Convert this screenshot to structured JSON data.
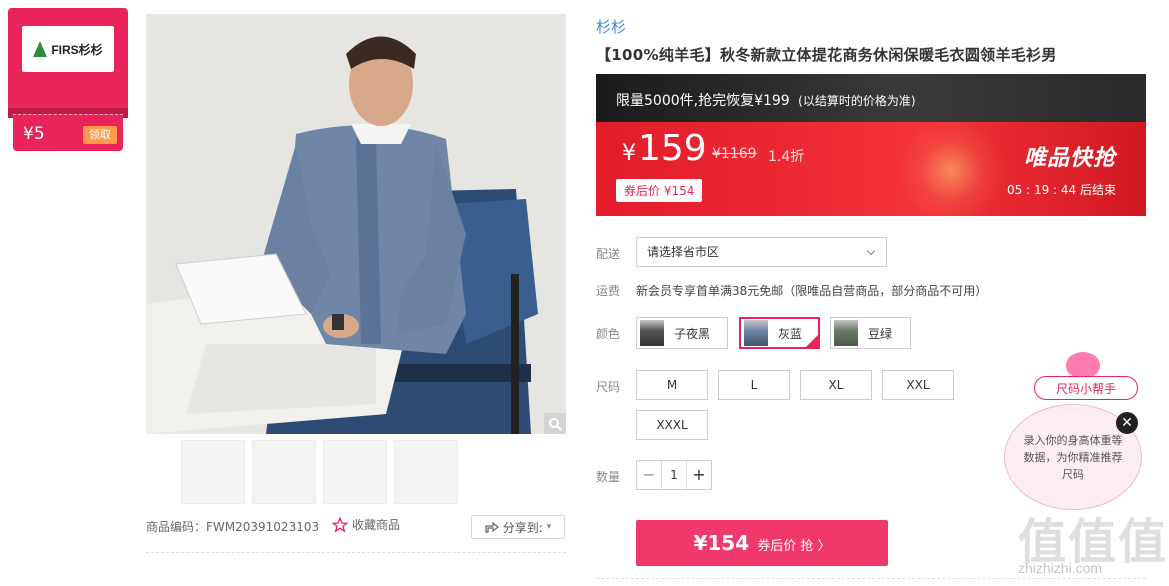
{
  "coupon": {
    "brand_logo_text": "FIRS杉杉",
    "amount": "¥5",
    "claim_label": "领取"
  },
  "gallery": {
    "sku_label": "商品编码：FWM20391023103",
    "favorite_label": "收藏商品",
    "share_label": "分享到:"
  },
  "product": {
    "brand": "杉杉",
    "title": "【100%纯羊毛】秋冬新款立体提花商务休闲保暖毛衣圆领羊毛衫男"
  },
  "promo": {
    "limit_text": "限量5000件,抢完恢复¥199",
    "limit_note": "(以结算时的价格为准)",
    "price_symbol": "¥",
    "price": "159",
    "original_price": "¥1169",
    "discount": "1.4折",
    "coupon_price": "券后价 ¥154",
    "flash_label": "唯品快抢",
    "countdown": "05 : 19 : 44  后结束"
  },
  "delivery": {
    "label": "配送",
    "placeholder": "请选择省市区"
  },
  "freight": {
    "label": "运费",
    "text": "新会员专享首单满38元免邮（限唯品自营商品，部分商品不可用）"
  },
  "colors": {
    "label": "颜色",
    "options": [
      "子夜黑",
      "灰蓝",
      "豆绿"
    ],
    "selected": "灰蓝"
  },
  "sizes": {
    "label": "尺码",
    "options": [
      "M",
      "L",
      "XL",
      "XXL",
      "XXXL"
    ]
  },
  "quantity": {
    "label": "数量",
    "minus": "−",
    "value": "1",
    "plus": "+"
  },
  "buy_button": {
    "price": "¥154",
    "suffix": "券后价 抢 〉"
  },
  "size_helper": {
    "tag": "尺码小帮手",
    "text": "录入你的身高体重等数据，为你精准推荐尺码",
    "close": "✕"
  },
  "watermark": {
    "glyphs": "值值值",
    "url": "zhizhizhi.com"
  }
}
